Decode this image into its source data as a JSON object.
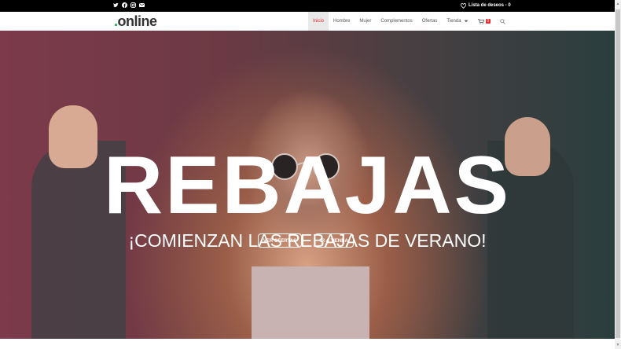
{
  "topbar": {
    "social_icons": [
      "twitter-icon",
      "facebook-icon",
      "instagram-icon",
      "email-icon"
    ],
    "wishlist_label": "Lista de deseos - 0"
  },
  "header": {
    "logo_dot": ".",
    "logo_text": "online",
    "nav": [
      {
        "label": "Inicio",
        "active": true
      },
      {
        "label": "Hombre"
      },
      {
        "label": "Mujer"
      },
      {
        "label": "Complementos"
      },
      {
        "label": "Ofertas"
      },
      {
        "label": "Tienda"
      }
    ],
    "cart_count": "0"
  },
  "hero": {
    "title": "REBAJAS",
    "subtitle": "¡COMIENZAN LAS REBAJAS DE VERANO!",
    "buttons": [
      {
        "label": "VER OFERTAS"
      },
      {
        "label": "IR A TIENDA"
      }
    ]
  },
  "colors": {
    "accent": "#e52d2d",
    "logo_dot": "#13aa52",
    "topbar": "#000000"
  }
}
